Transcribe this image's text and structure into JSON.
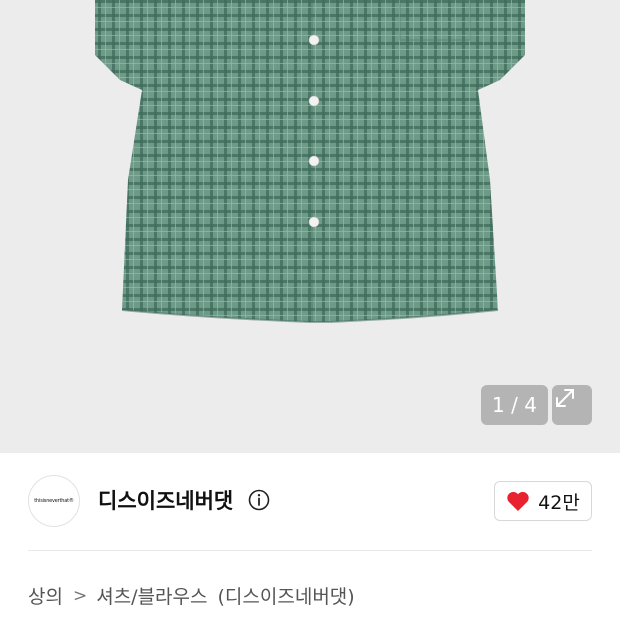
{
  "gallery": {
    "current": "1",
    "separator": " / ",
    "total": "4",
    "expand_icon": "expand-arrows-icon",
    "shirt_color": "#5f8e7c"
  },
  "brand": {
    "logo_text": "thisisneverthat®",
    "name": "디스이즈네버댓",
    "info_icon": "info-circle-icon"
  },
  "like": {
    "icon": "heart-icon",
    "color": "#e8222e",
    "count": "42만"
  },
  "breadcrumb": {
    "category": "상의",
    "separator": ">",
    "subcategory": "셔츠/블라우스",
    "brand_suffix": "(디스이즈네버댓)"
  }
}
